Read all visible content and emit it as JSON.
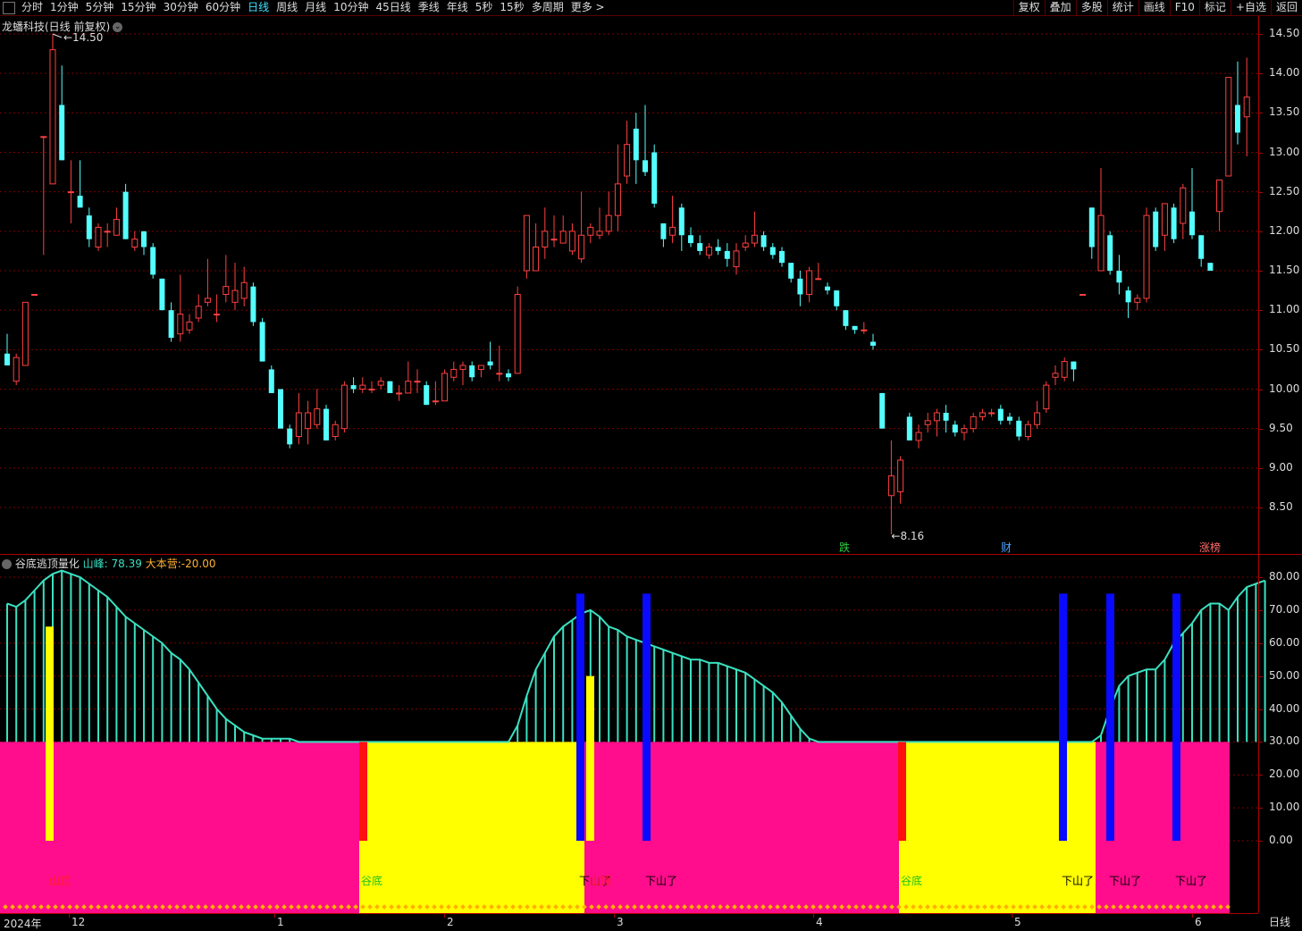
{
  "toolbar": {
    "tabs": [
      "分时",
      "1分钟",
      "5分钟",
      "15分钟",
      "30分钟",
      "60分钟",
      "日线",
      "周线",
      "月线",
      "10分钟",
      "45日线",
      "季线",
      "年线",
      "5秒",
      "15秒",
      "多周期",
      "更多 >"
    ],
    "active_tab": "日线",
    "right_buttons": [
      "复权",
      "叠加",
      "多股",
      "统计",
      "画线",
      "F10",
      "标记",
      "+自选",
      "返回"
    ]
  },
  "chart_title": {
    "stock": "龙蟠科技(日线 前复权)"
  },
  "price_panel": {
    "y_labels": [
      "14.50",
      "14.00",
      "13.50",
      "13.00",
      "12.50",
      "12.00",
      "11.50",
      "11.00",
      "10.50",
      "10.00",
      "9.50",
      "9.00",
      "8.50"
    ],
    "high_marker": "14.50",
    "low_marker": "8.16",
    "badges": [
      {
        "text": "跌",
        "color": "#2ecc40"
      },
      {
        "text": "财",
        "color": "#4aa3ff"
      },
      {
        "text": "涨榜",
        "color": "#ff6a6a"
      }
    ]
  },
  "indicator_panel": {
    "name": "谷底逃顶量化",
    "series1_label": "山峰:",
    "series1_value": "78.39",
    "series2_label": "大本营:",
    "series2_value": "-20.00",
    "y_labels": [
      "80.00",
      "70.00",
      "60.00",
      "50.00",
      "40.00",
      "30.00",
      "20.00",
      "10.00",
      "0.00"
    ],
    "signals": [
      {
        "text": "山顶",
        "color": "#ff2020"
      },
      {
        "text": "谷底",
        "color": "#20c020"
      },
      {
        "text": "下山了",
        "color": "#000000"
      },
      {
        "text": "山顶",
        "color": "#ff2020"
      },
      {
        "text": "下山了",
        "color": "#000000"
      },
      {
        "text": "谷底",
        "color": "#20c020"
      },
      {
        "text": "下山了",
        "color": "#000000"
      },
      {
        "text": "下山了",
        "color": "#000000"
      },
      {
        "text": "下山了",
        "color": "#000000"
      }
    ]
  },
  "x_axis": {
    "labels": [
      "2024年",
      "12",
      "1",
      "2",
      "3",
      "4",
      "5",
      "6"
    ],
    "period": "日线"
  },
  "colors": {
    "up": "#ff4040",
    "down": "#54ffff",
    "magenta": "#ff0d8c",
    "yellow": "#ffff00",
    "teal": "#3ae0c0",
    "blue": "#0a0aff"
  },
  "chart_data": {
    "type": "candlestick",
    "ylim": [
      8.0,
      14.7
    ],
    "candles": [
      {
        "o": 10.45,
        "h": 10.7,
        "l": 10.3,
        "c": 10.3
      },
      {
        "o": 10.1,
        "h": 10.45,
        "l": 10.05,
        "c": 10.4
      },
      {
        "o": 10.3,
        "h": 11.1,
        "l": 10.3,
        "c": 11.1
      },
      {
        "o": 11.2,
        "h": 11.2,
        "l": 11.2,
        "c": 11.2
      },
      {
        "o": 13.2,
        "h": 13.2,
        "l": 11.7,
        "c": 13.2
      },
      {
        "o": 12.6,
        "h": 14.5,
        "l": 12.6,
        "c": 14.3
      },
      {
        "o": 13.6,
        "h": 14.1,
        "l": 12.9,
        "c": 12.9
      },
      {
        "o": 12.5,
        "h": 12.9,
        "l": 12.1,
        "c": 12.5
      },
      {
        "o": 12.45,
        "h": 12.9,
        "l": 12.3,
        "c": 12.3
      },
      {
        "o": 12.2,
        "h": 12.3,
        "l": 11.8,
        "c": 11.9
      },
      {
        "o": 11.8,
        "h": 12.1,
        "l": 11.75,
        "c": 12.05
      },
      {
        "o": 12.0,
        "h": 12.1,
        "l": 11.8,
        "c": 12.0
      },
      {
        "o": 11.95,
        "h": 12.3,
        "l": 11.95,
        "c": 12.15
      },
      {
        "o": 12.5,
        "h": 12.6,
        "l": 11.9,
        "c": 11.9
      },
      {
        "o": 11.8,
        "h": 12.0,
        "l": 11.75,
        "c": 11.9
      },
      {
        "o": 12.0,
        "h": 12.0,
        "l": 11.7,
        "c": 11.8
      },
      {
        "o": 11.8,
        "h": 11.85,
        "l": 11.4,
        "c": 11.45
      },
      {
        "o": 11.4,
        "h": 11.4,
        "l": 11.0,
        "c": 11.0
      },
      {
        "o": 11.0,
        "h": 11.1,
        "l": 10.6,
        "c": 10.65
      },
      {
        "o": 10.7,
        "h": 11.45,
        "l": 10.6,
        "c": 10.95
      },
      {
        "o": 10.75,
        "h": 10.95,
        "l": 10.7,
        "c": 10.85
      },
      {
        "o": 10.9,
        "h": 11.2,
        "l": 10.85,
        "c": 11.05
      },
      {
        "o": 11.1,
        "h": 11.65,
        "l": 11.05,
        "c": 11.15
      },
      {
        "o": 10.95,
        "h": 11.2,
        "l": 10.85,
        "c": 10.95
      },
      {
        "o": 11.2,
        "h": 11.7,
        "l": 11.1,
        "c": 11.3
      },
      {
        "o": 11.1,
        "h": 11.6,
        "l": 11.0,
        "c": 11.25
      },
      {
        "o": 11.15,
        "h": 11.55,
        "l": 11.05,
        "c": 11.35
      },
      {
        "o": 11.3,
        "h": 11.35,
        "l": 10.8,
        "c": 10.85
      },
      {
        "o": 10.85,
        "h": 10.9,
        "l": 10.35,
        "c": 10.35
      },
      {
        "o": 10.25,
        "h": 10.3,
        "l": 9.95,
        "c": 9.95
      },
      {
        "o": 10.0,
        "h": 10.0,
        "l": 9.5,
        "c": 9.5
      },
      {
        "o": 9.5,
        "h": 9.55,
        "l": 9.25,
        "c": 9.3
      },
      {
        "o": 9.4,
        "h": 9.95,
        "l": 9.3,
        "c": 9.7
      },
      {
        "o": 9.5,
        "h": 9.85,
        "l": 9.3,
        "c": 9.7
      },
      {
        "o": 9.55,
        "h": 10.0,
        "l": 9.5,
        "c": 9.75
      },
      {
        "o": 9.75,
        "h": 9.8,
        "l": 9.35,
        "c": 9.35
      },
      {
        "o": 9.4,
        "h": 9.6,
        "l": 9.35,
        "c": 9.55
      },
      {
        "o": 9.5,
        "h": 10.1,
        "l": 9.45,
        "c": 10.05
      },
      {
        "o": 10.05,
        "h": 10.15,
        "l": 9.95,
        "c": 10.0
      },
      {
        "o": 10.0,
        "h": 10.15,
        "l": 9.95,
        "c": 10.05
      },
      {
        "o": 10.0,
        "h": 10.1,
        "l": 9.95,
        "c": 10.0
      },
      {
        "o": 10.05,
        "h": 10.15,
        "l": 10.0,
        "c": 10.1
      },
      {
        "o": 10.1,
        "h": 10.1,
        "l": 9.95,
        "c": 9.95
      },
      {
        "o": 9.95,
        "h": 10.05,
        "l": 9.85,
        "c": 9.95
      },
      {
        "o": 9.95,
        "h": 10.35,
        "l": 9.95,
        "c": 10.1
      },
      {
        "o": 10.1,
        "h": 10.25,
        "l": 9.95,
        "c": 10.1
      },
      {
        "o": 10.05,
        "h": 10.1,
        "l": 9.8,
        "c": 9.8
      },
      {
        "o": 9.85,
        "h": 10.1,
        "l": 9.8,
        "c": 9.85
      },
      {
        "o": 9.85,
        "h": 10.25,
        "l": 9.85,
        "c": 10.2
      },
      {
        "o": 10.15,
        "h": 10.35,
        "l": 10.1,
        "c": 10.25
      },
      {
        "o": 10.25,
        "h": 10.35,
        "l": 10.05,
        "c": 10.3
      },
      {
        "o": 10.3,
        "h": 10.35,
        "l": 10.1,
        "c": 10.15
      },
      {
        "o": 10.25,
        "h": 10.3,
        "l": 10.15,
        "c": 10.3
      },
      {
        "o": 10.35,
        "h": 10.6,
        "l": 10.25,
        "c": 10.3
      },
      {
        "o": 10.2,
        "h": 10.55,
        "l": 10.1,
        "c": 10.2
      },
      {
        "o": 10.2,
        "h": 10.25,
        "l": 10.1,
        "c": 10.15
      },
      {
        "o": 10.2,
        "h": 11.3,
        "l": 10.2,
        "c": 11.2
      },
      {
        "o": 11.5,
        "h": 12.2,
        "l": 11.4,
        "c": 12.2
      },
      {
        "o": 11.5,
        "h": 12.1,
        "l": 11.5,
        "c": 11.8
      },
      {
        "o": 11.8,
        "h": 12.3,
        "l": 11.65,
        "c": 12.0
      },
      {
        "o": 11.9,
        "h": 12.2,
        "l": 11.8,
        "c": 11.9
      },
      {
        "o": 11.85,
        "h": 12.2,
        "l": 11.85,
        "c": 12.0
      },
      {
        "o": 11.75,
        "h": 12.1,
        "l": 11.7,
        "c": 12.0
      },
      {
        "o": 11.65,
        "h": 12.5,
        "l": 11.6,
        "c": 11.95
      },
      {
        "o": 11.95,
        "h": 12.1,
        "l": 11.85,
        "c": 12.05
      },
      {
        "o": 11.95,
        "h": 12.3,
        "l": 11.9,
        "c": 12.0
      },
      {
        "o": 12.0,
        "h": 12.5,
        "l": 11.95,
        "c": 12.2
      },
      {
        "o": 12.2,
        "h": 13.1,
        "l": 12.0,
        "c": 12.6
      },
      {
        "o": 12.7,
        "h": 13.4,
        "l": 12.6,
        "c": 13.1
      },
      {
        "o": 13.3,
        "h": 13.5,
        "l": 12.6,
        "c": 12.9
      },
      {
        "o": 12.9,
        "h": 13.6,
        "l": 12.7,
        "c": 12.75
      },
      {
        "o": 13.0,
        "h": 13.1,
        "l": 12.3,
        "c": 12.35
      },
      {
        "o": 12.1,
        "h": 12.1,
        "l": 11.8,
        "c": 11.9
      },
      {
        "o": 11.95,
        "h": 12.45,
        "l": 11.85,
        "c": 12.05
      },
      {
        "o": 12.3,
        "h": 12.35,
        "l": 11.75,
        "c": 11.95
      },
      {
        "o": 11.95,
        "h": 12.05,
        "l": 11.8,
        "c": 11.85
      },
      {
        "o": 11.85,
        "h": 11.95,
        "l": 11.7,
        "c": 11.75
      },
      {
        "o": 11.7,
        "h": 11.85,
        "l": 11.65,
        "c": 11.8
      },
      {
        "o": 11.8,
        "h": 11.9,
        "l": 11.7,
        "c": 11.75
      },
      {
        "o": 11.75,
        "h": 11.85,
        "l": 11.55,
        "c": 11.65
      },
      {
        "o": 11.55,
        "h": 11.85,
        "l": 11.45,
        "c": 11.75
      },
      {
        "o": 11.8,
        "h": 11.95,
        "l": 11.75,
        "c": 11.85
      },
      {
        "o": 11.85,
        "h": 12.25,
        "l": 11.8,
        "c": 11.95
      },
      {
        "o": 11.95,
        "h": 12.0,
        "l": 11.75,
        "c": 11.8
      },
      {
        "o": 11.8,
        "h": 11.85,
        "l": 11.65,
        "c": 11.7
      },
      {
        "o": 11.75,
        "h": 11.8,
        "l": 11.55,
        "c": 11.6
      },
      {
        "o": 11.6,
        "h": 11.6,
        "l": 11.35,
        "c": 11.4
      },
      {
        "o": 11.4,
        "h": 11.5,
        "l": 11.05,
        "c": 11.2
      },
      {
        "o": 11.2,
        "h": 11.55,
        "l": 11.1,
        "c": 11.5
      },
      {
        "o": 11.4,
        "h": 11.6,
        "l": 11.4,
        "c": 11.4
      },
      {
        "o": 11.3,
        "h": 11.35,
        "l": 11.2,
        "c": 11.25
      },
      {
        "o": 11.25,
        "h": 11.25,
        "l": 11.0,
        "c": 11.05
      },
      {
        "o": 11.0,
        "h": 11.0,
        "l": 10.75,
        "c": 10.8
      },
      {
        "o": 10.8,
        "h": 10.8,
        "l": 10.7,
        "c": 10.75
      },
      {
        "o": 10.75,
        "h": 10.85,
        "l": 10.7,
        "c": 10.75
      },
      {
        "o": 10.6,
        "h": 10.7,
        "l": 10.5,
        "c": 10.55
      },
      {
        "o": 9.95,
        "h": 9.95,
        "l": 9.5,
        "c": 9.5
      },
      {
        "o": 8.65,
        "h": 9.35,
        "l": 8.16,
        "c": 8.9
      },
      {
        "o": 8.7,
        "h": 9.15,
        "l": 8.55,
        "c": 9.1
      },
      {
        "o": 9.65,
        "h": 9.7,
        "l": 9.35,
        "c": 9.35
      },
      {
        "o": 9.35,
        "h": 9.55,
        "l": 9.25,
        "c": 9.45
      },
      {
        "o": 9.55,
        "h": 9.7,
        "l": 9.45,
        "c": 9.6
      },
      {
        "o": 9.6,
        "h": 9.75,
        "l": 9.4,
        "c": 9.7
      },
      {
        "o": 9.7,
        "h": 9.8,
        "l": 9.45,
        "c": 9.6
      },
      {
        "o": 9.55,
        "h": 9.6,
        "l": 9.4,
        "c": 9.45
      },
      {
        "o": 9.45,
        "h": 9.55,
        "l": 9.35,
        "c": 9.5
      },
      {
        "o": 9.5,
        "h": 9.7,
        "l": 9.45,
        "c": 9.65
      },
      {
        "o": 9.65,
        "h": 9.75,
        "l": 9.6,
        "c": 9.7
      },
      {
        "o": 9.7,
        "h": 9.75,
        "l": 9.65,
        "c": 9.7
      },
      {
        "o": 9.75,
        "h": 9.8,
        "l": 9.55,
        "c": 9.6
      },
      {
        "o": 9.65,
        "h": 9.7,
        "l": 9.55,
        "c": 9.6
      },
      {
        "o": 9.6,
        "h": 9.65,
        "l": 9.35,
        "c": 9.4
      },
      {
        "o": 9.4,
        "h": 9.6,
        "l": 9.35,
        "c": 9.55
      },
      {
        "o": 9.55,
        "h": 9.85,
        "l": 9.5,
        "c": 9.7
      },
      {
        "o": 9.75,
        "h": 10.1,
        "l": 9.7,
        "c": 10.05
      },
      {
        "o": 10.15,
        "h": 10.3,
        "l": 10.05,
        "c": 10.2
      },
      {
        "o": 10.15,
        "h": 10.4,
        "l": 10.1,
        "c": 10.35
      },
      {
        "o": 10.35,
        "h": 10.35,
        "l": 10.1,
        "c": 10.25
      },
      {
        "o": 11.2,
        "h": 11.2,
        "l": 11.2,
        "c": 11.2
      },
      {
        "o": 12.3,
        "h": 12.3,
        "l": 11.65,
        "c": 11.8
      },
      {
        "o": 11.5,
        "h": 12.8,
        "l": 11.5,
        "c": 12.2
      },
      {
        "o": 11.95,
        "h": 12.0,
        "l": 11.45,
        "c": 11.5
      },
      {
        "o": 11.5,
        "h": 11.7,
        "l": 11.2,
        "c": 11.35
      },
      {
        "o": 11.25,
        "h": 11.3,
        "l": 10.9,
        "c": 11.1
      },
      {
        "o": 11.1,
        "h": 11.2,
        "l": 11.0,
        "c": 11.15
      },
      {
        "o": 11.15,
        "h": 12.3,
        "l": 11.1,
        "c": 12.2
      },
      {
        "o": 12.25,
        "h": 12.3,
        "l": 11.75,
        "c": 11.8
      },
      {
        "o": 11.95,
        "h": 12.3,
        "l": 11.75,
        "c": 12.35
      },
      {
        "o": 12.3,
        "h": 12.35,
        "l": 11.85,
        "c": 11.9
      },
      {
        "o": 12.1,
        "h": 12.6,
        "l": 11.9,
        "c": 12.55
      },
      {
        "o": 12.25,
        "h": 12.8,
        "l": 11.9,
        "c": 11.95
      },
      {
        "o": 11.95,
        "h": 11.95,
        "l": 11.55,
        "c": 11.65
      },
      {
        "o": 11.6,
        "h": 11.6,
        "l": 11.5,
        "c": 11.5
      },
      {
        "o": 12.25,
        "h": 12.65,
        "l": 12.0,
        "c": 12.65
      },
      {
        "o": 12.7,
        "h": 13.95,
        "l": 12.7,
        "c": 13.95
      },
      {
        "o": 13.6,
        "h": 14.15,
        "l": 13.1,
        "c": 13.25
      },
      {
        "o": 13.45,
        "h": 14.2,
        "l": 12.95,
        "c": 13.7
      }
    ],
    "indicator": {
      "name": "山峰",
      "ylim": [
        -20,
        82
      ],
      "values": [
        72,
        71,
        73,
        76,
        79,
        81,
        82,
        81,
        80,
        78,
        76,
        74,
        71,
        68,
        66,
        64,
        62,
        60,
        57,
        55,
        52,
        48,
        44,
        40,
        37,
        35,
        33,
        32,
        31,
        31,
        31,
        31,
        30,
        30,
        30,
        30,
        30,
        30,
        30,
        30,
        30,
        30,
        30,
        30,
        30,
        30,
        30,
        30,
        30,
        30,
        30,
        30,
        30,
        30,
        30,
        30,
        35,
        44,
        52,
        57,
        62,
        65,
        67,
        69,
        70,
        68,
        65,
        64,
        62,
        61,
        60,
        59,
        58,
        57,
        56,
        55,
        55,
        54,
        54,
        53,
        52,
        51,
        49,
        47,
        45,
        42,
        38,
        34,
        31,
        30,
        30,
        30,
        30,
        30,
        30,
        30,
        30,
        30,
        30,
        30,
        30,
        30,
        30,
        30,
        30,
        30,
        30,
        30,
        30,
        30,
        30,
        30,
        30,
        30,
        30,
        30,
        30,
        30,
        30,
        30,
        32,
        40,
        47,
        50,
        51,
        52,
        52,
        55,
        60,
        63,
        66,
        70,
        72,
        72,
        70,
        74,
        77,
        78,
        79
      ]
    }
  }
}
